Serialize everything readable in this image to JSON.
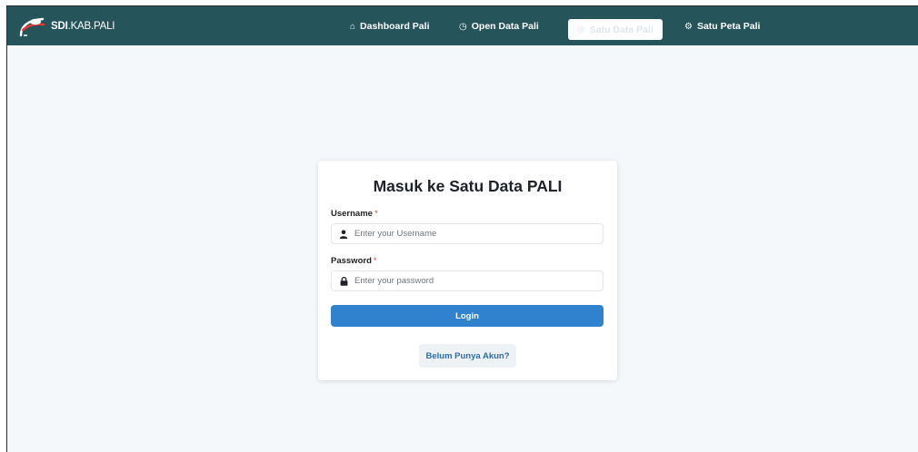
{
  "brand": {
    "strong": "SDI",
    "light": ".KAB.PALI",
    "logo_icon": "swoosh-logo"
  },
  "nav": {
    "items": [
      {
        "label": "Dashboard Pali",
        "icon": "⌂"
      },
      {
        "label": "Open Data Pali",
        "icon": "◷"
      },
      {
        "label": "Satu Data Pali",
        "icon": "◎"
      },
      {
        "label": "Satu Peta Pali",
        "icon": "⚙"
      }
    ],
    "active": "Satu Data Pali"
  },
  "login": {
    "title": "Masuk ke Satu Data PALI",
    "username_label": "Username",
    "username_placeholder": "Enter your Username",
    "password_label": "Password",
    "password_placeholder": "Enter your password",
    "required_mark": "*",
    "submit_label": "Login",
    "signup_label": "Belum Punya Akun?"
  },
  "colors": {
    "navbar": "#25545a",
    "page_bg": "#f4f8fb",
    "primary": "#3182ce",
    "link": "#2b6cb0",
    "required": "#e0443e"
  }
}
